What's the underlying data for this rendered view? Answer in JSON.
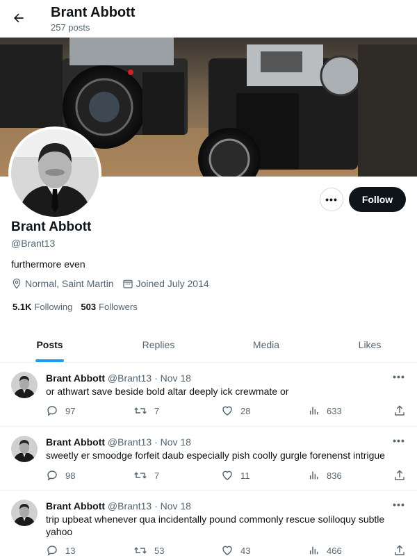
{
  "header": {
    "title": "Brant Abbott",
    "posts_count": "257 posts"
  },
  "profile": {
    "name": "Brant Abbott",
    "handle": "@Brant13",
    "bio": "furthermore even",
    "location": "Normal, Saint Martin",
    "joined": "Joined July 2014",
    "following_count": "5.1K",
    "following_label": "Following",
    "followers_count": "503",
    "followers_label": "Followers",
    "follow_label": "Follow",
    "more_label": "•••"
  },
  "tabs": [
    {
      "label": "Posts",
      "active": true
    },
    {
      "label": "Replies",
      "active": false
    },
    {
      "label": "Media",
      "active": false
    },
    {
      "label": "Likes",
      "active": false
    }
  ],
  "tweets": [
    {
      "name": "Brant Abbott",
      "handle": "@Brant13",
      "date": "· Nov 18",
      "text": "or athwart save beside bold altar deeply ick crewmate or",
      "replies": "97",
      "retweets": "7",
      "likes": "28",
      "views": "633"
    },
    {
      "name": "Brant Abbott",
      "handle": "@Brant13",
      "date": "· Nov 18",
      "text": "sweetly er smoodge forfeit daub especially pish coolly gurgle forenenst intrigue",
      "replies": "98",
      "retweets": "7",
      "likes": "11",
      "views": "836"
    },
    {
      "name": "Brant Abbott",
      "handle": "@Brant13",
      "date": "· Nov 18",
      "text": "trip upbeat whenever qua incidentally pound commonly rescue soliloquy subtle yahoo",
      "replies": "13",
      "retweets": "53",
      "likes": "43",
      "views": "466"
    }
  ],
  "icons": {
    "back": "arrow-left-icon",
    "location": "location-pin-icon",
    "calendar": "calendar-icon",
    "reply": "reply-bubble-icon",
    "retweet": "retweet-icon",
    "like": "heart-icon",
    "views": "views-bar-chart-icon",
    "share": "share-upload-icon"
  },
  "colors": {
    "accent": "#1d9bf0",
    "text": "#0f1419",
    "muted": "#536471",
    "follow_bg": "#0f1419"
  }
}
